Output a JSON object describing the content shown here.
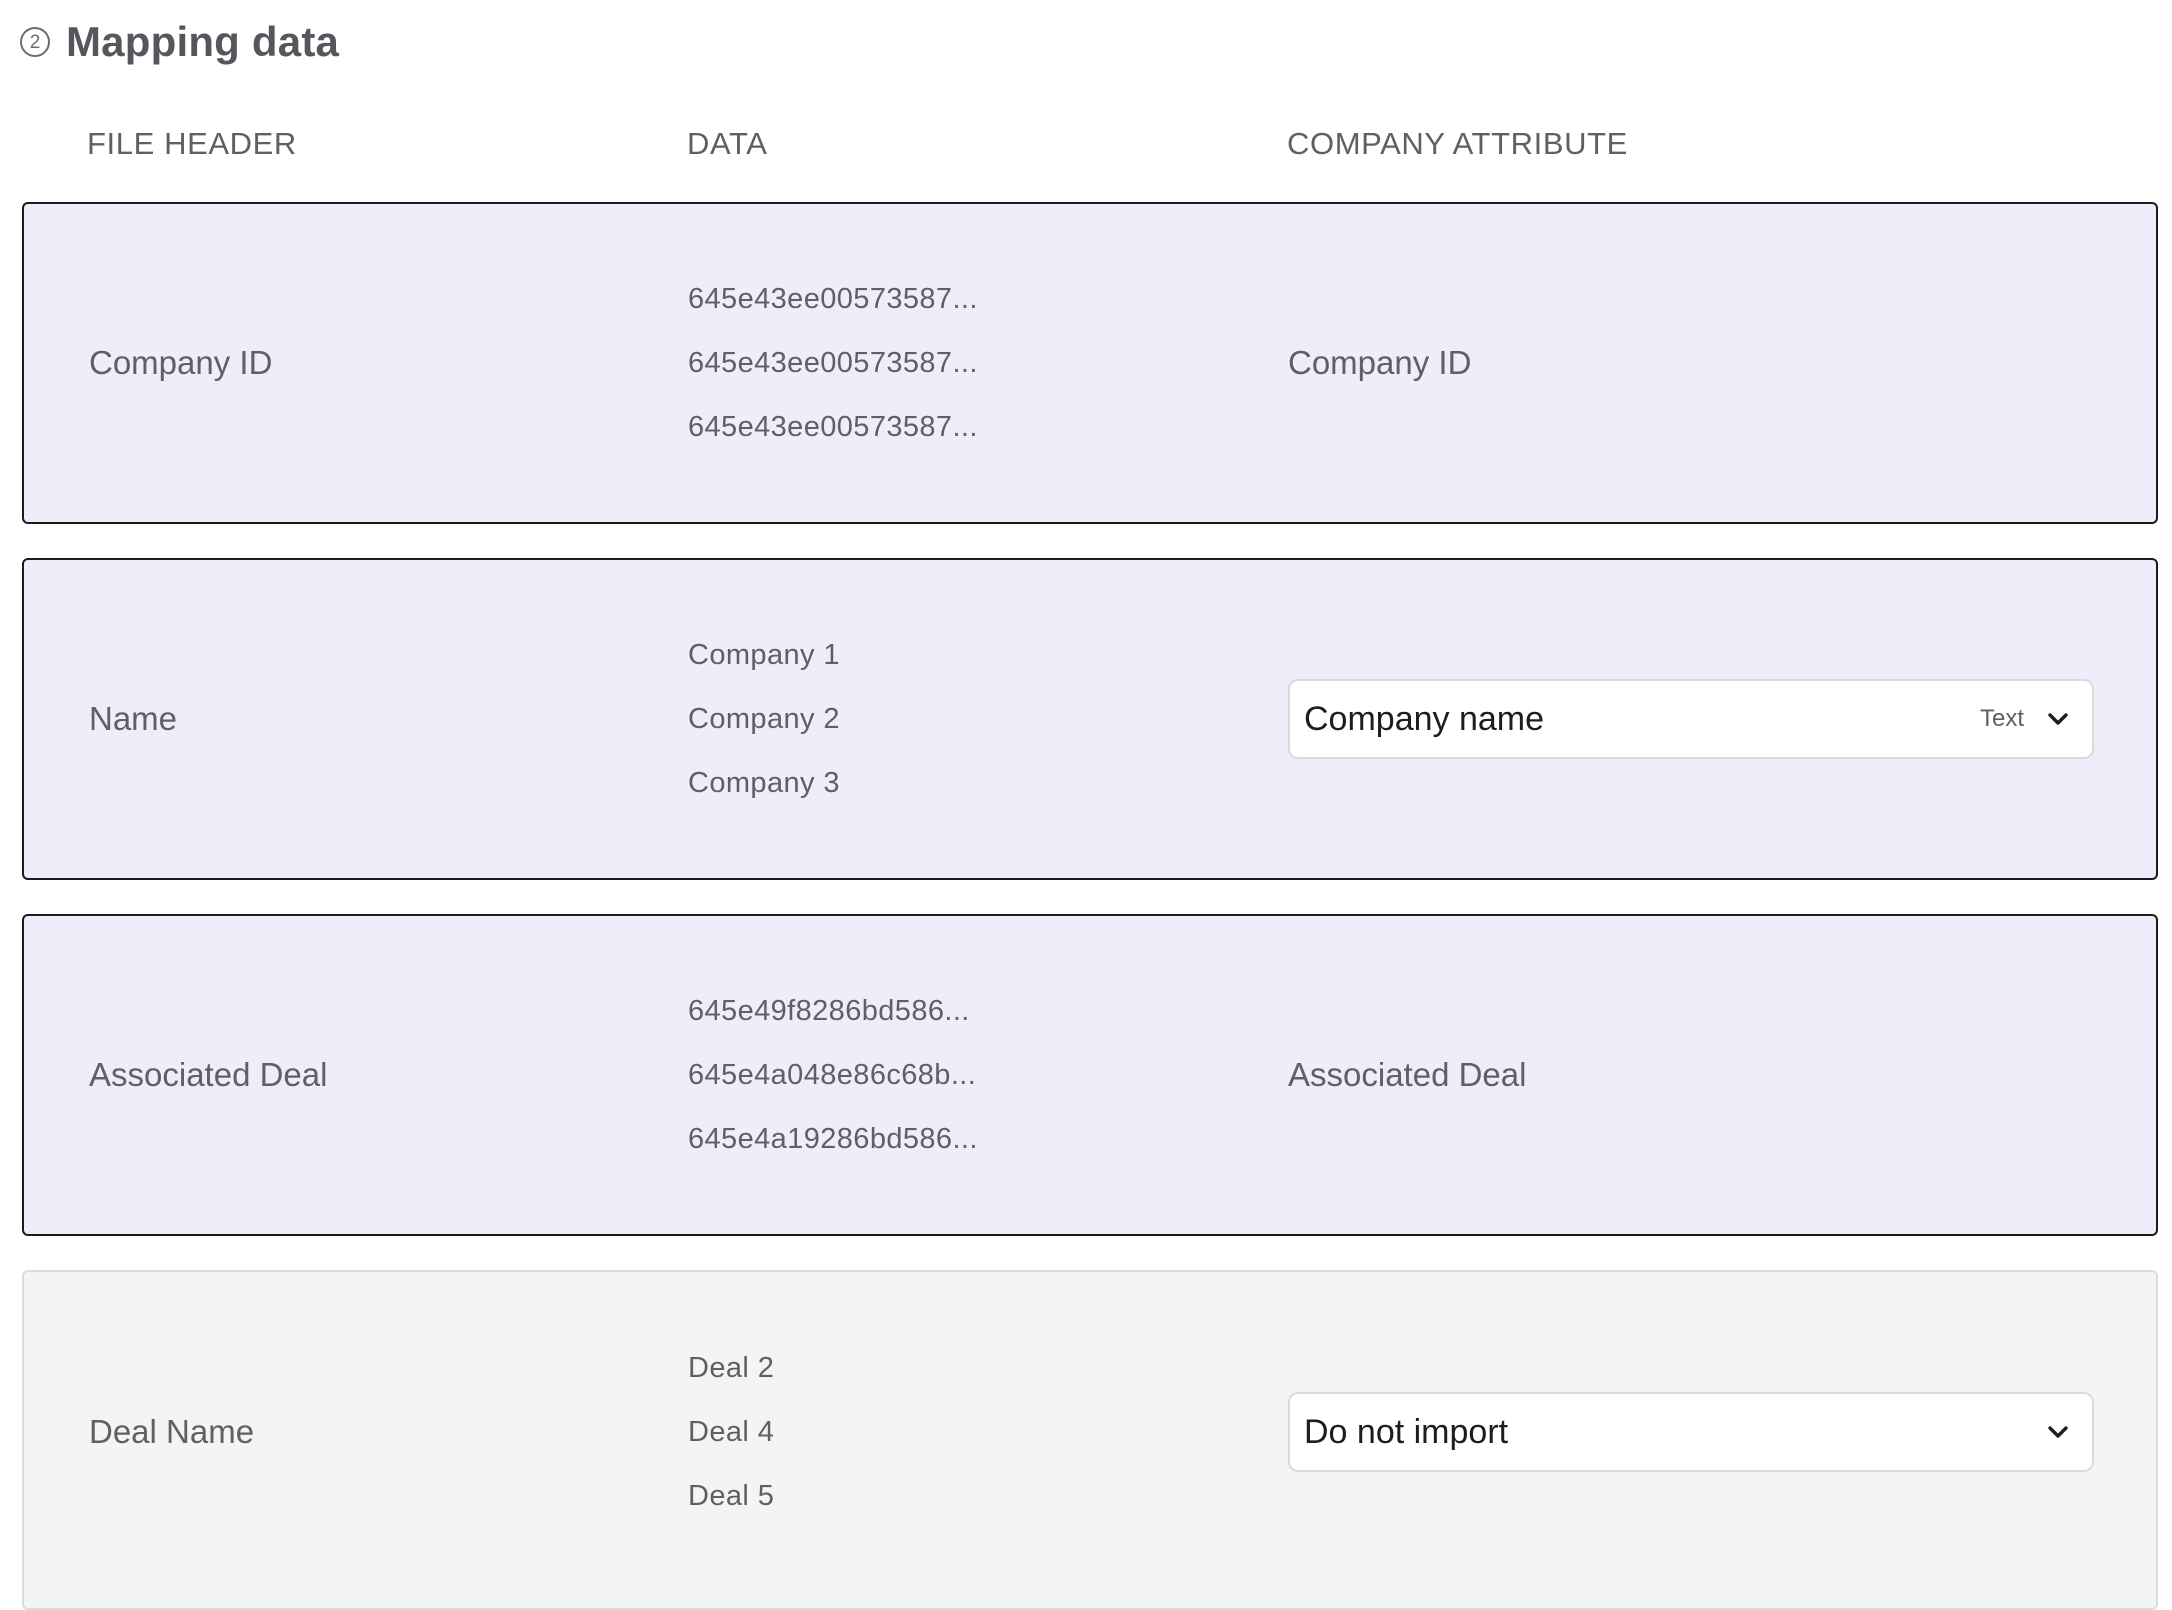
{
  "section": {
    "step": "2",
    "title": "Mapping data"
  },
  "columns": {
    "file_header": "FILE HEADER",
    "data": "DATA",
    "attribute": "COMPANY ATTRIBUTE"
  },
  "rows": [
    {
      "file_header": "Company ID",
      "samples": [
        "645e43ee00573587...",
        "645e43ee00573587...",
        "645e43ee00573587..."
      ],
      "attribute": "Company ID"
    },
    {
      "file_header": "Name",
      "samples": [
        "Company 1",
        "Company 2",
        "Company 3"
      ],
      "select_value": "Company name",
      "select_type": "Text"
    },
    {
      "file_header": "Associated Deal",
      "samples": [
        "645e49f8286bd586...",
        "645e4a048e86c68b...",
        "645e4a19286bd586..."
      ],
      "attribute": "Associated Deal"
    },
    {
      "file_header": "Deal Name",
      "samples": [
        "Deal 2",
        "Deal 4",
        "Deal 5"
      ],
      "select_value": "Do not import"
    }
  ],
  "icons": {
    "step_badge": "circled-two-icon",
    "dropdown": "chevron-down-icon"
  },
  "colors": {
    "mapped_row_bg": "#eeeefb",
    "mapped_row_border": "#1b1b1d",
    "unmapped_row_bg": "#f4f4f5",
    "unmapped_row_border": "#dcdcdf"
  }
}
